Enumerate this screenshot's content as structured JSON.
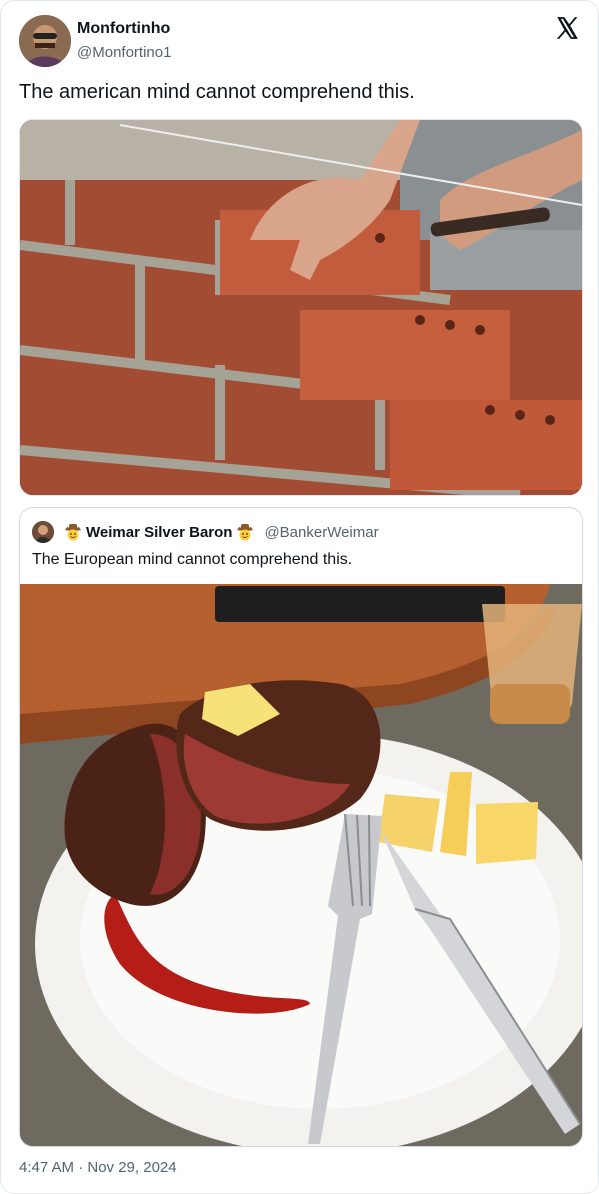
{
  "tweet": {
    "author_name": "Monfortinho",
    "author_handle": "@Monfortino1",
    "text": "The american mind cannot comprehend this.",
    "timestamp": "4:47 AM · Nov 29, 2024",
    "logo_icon": "x-logo-icon"
  },
  "quoted_tweet": {
    "author_name": "Weimar Silver Baron",
    "author_handle": "@BankerWeimar",
    "text": "The European mind cannot comprehend this.",
    "emoji_icon": "cowboy-emoji-icon"
  },
  "colors": {
    "text_primary": "#0f1419",
    "text_secondary": "#536471",
    "border": "#e1e8ed"
  }
}
